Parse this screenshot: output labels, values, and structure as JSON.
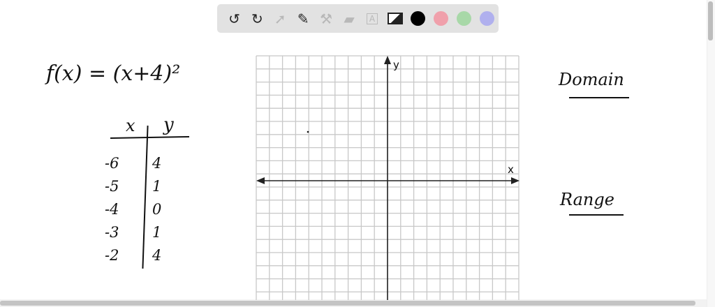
{
  "toolbar": {
    "tools": [
      "undo-icon",
      "redo-icon",
      "select-icon",
      "pen-icon",
      "tools-icon",
      "eraser-icon",
      "text-icon",
      "image-icon"
    ],
    "colors": [
      "#000000",
      "#f0a0ab",
      "#a8d8a8",
      "#b0b0ee"
    ]
  },
  "notes": {
    "function": "f(x) = (x+4)²",
    "table_header_x": "x",
    "table_header_y": "y",
    "table_rows": [
      [
        "-6",
        "4"
      ],
      [
        "-5",
        "1"
      ],
      [
        "-4",
        "0"
      ],
      [
        "-3",
        "1"
      ],
      [
        "-2",
        "4"
      ]
    ],
    "domain_label": "Domain",
    "range_label": "Range"
  },
  "graph": {
    "x_label": "x",
    "y_label": "y"
  }
}
